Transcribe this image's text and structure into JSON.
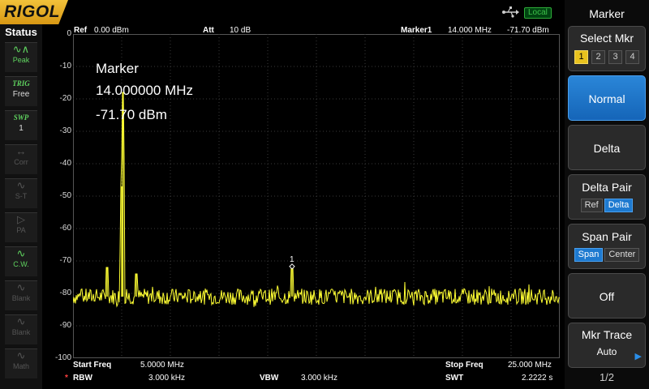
{
  "brand": "RIGOL",
  "local_label": "Local",
  "status": {
    "title": "Status",
    "items": [
      {
        "icon": "peak-icon",
        "label": "Peak",
        "state": "on"
      },
      {
        "icon": "trig-icon",
        "top": "TRIG",
        "label": "Free",
        "state": "on"
      },
      {
        "icon": "swp-icon",
        "top": "SWP",
        "label": "1",
        "state": "on"
      },
      {
        "icon": "corr-icon",
        "label": "Corr",
        "state": "dim"
      },
      {
        "icon": "st-icon",
        "label": "S-T",
        "state": "dim"
      },
      {
        "icon": "pa-icon",
        "label": "PA",
        "state": "dim"
      },
      {
        "icon": "cw-icon",
        "label": "C.W.",
        "state": "on"
      },
      {
        "icon": "blank-icon",
        "label": "Blank",
        "state": "dim"
      },
      {
        "icon": "blank-icon",
        "label": "Blank",
        "state": "dim"
      },
      {
        "icon": "math-icon",
        "label": "Math",
        "state": "dim"
      }
    ]
  },
  "header": {
    "ref_label": "Ref",
    "ref_value": "0.00 dBm",
    "att_label": "Att",
    "att_value": "10 dB",
    "marker_label": "Marker1",
    "marker_freq": "14.000 MHz",
    "marker_level": "-71.70 dBm"
  },
  "marker_readout": {
    "title": "Marker",
    "freq": "14.000000 MHz",
    "level": "-71.70 dBm",
    "marker_number": "1"
  },
  "y_ticks": [
    "0",
    "-10",
    "-20",
    "-30",
    "-40",
    "-50",
    "-60",
    "-70",
    "-80",
    "-90",
    "-100"
  ],
  "footer": {
    "start_label": "Start Freq",
    "start_value": "5.0000 MHz",
    "stop_label": "Stop Freq",
    "stop_value": "25.000 MHz",
    "rbw_star": "*",
    "rbw_label": "RBW",
    "rbw_value": "3.000 kHz",
    "vbw_label": "VBW",
    "vbw_value": "3.000 kHz",
    "swt_label": "SWT",
    "swt_value": "2.2222 s"
  },
  "menu": {
    "title": "Marker",
    "select_mkr": "Select Mkr",
    "mkr_numbers": [
      "1",
      "2",
      "3",
      "4"
    ],
    "selected_mkr": "1",
    "normal": "Normal",
    "delta": "Delta",
    "delta_pair": "Delta Pair",
    "delta_pair_ref": "Ref",
    "delta_pair_delta": "Delta",
    "span_pair": "Span Pair",
    "span_pair_span": "Span",
    "span_pair_center": "Center",
    "off": "Off",
    "mkr_trace": "Mkr Trace",
    "mkr_trace_value": "Auto",
    "page": "1/2"
  },
  "chart_data": {
    "type": "line",
    "xlim": [
      5.0,
      25.0
    ],
    "ylim": [
      -100,
      0
    ],
    "noise_floor": -81,
    "peaks": [
      {
        "freq": 6.4,
        "level": -72
      },
      {
        "freq": 7.0,
        "level": -47
      },
      {
        "freq": 7.05,
        "level": -18
      },
      {
        "freq": 7.6,
        "level": -74
      },
      {
        "freq": 14.0,
        "level": -71.7
      }
    ],
    "marker": {
      "freq": 14.0,
      "level": -71.7
    },
    "colors": {
      "trace": "#ffff33",
      "grid": "#3a3a3a"
    },
    "grid": true
  },
  "colors": {
    "accent": "#1e7ad0",
    "selected": "#e8c21e",
    "status_on": "#5fd35f"
  }
}
